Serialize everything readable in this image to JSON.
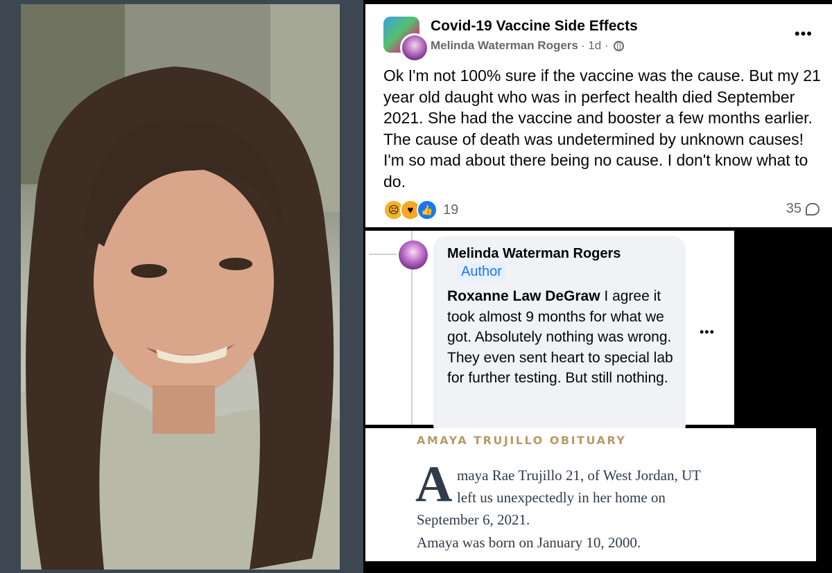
{
  "post": {
    "group_name": "Covid-19 Vaccine Side Effects",
    "author": "Melinda Waterman Rogers",
    "time": "· 1d ·",
    "more": "•••",
    "text": "Ok I'm not 100% sure if the vaccine was the cause. But my 21 year old daught who was in perfect health died September 2021. She had the vaccine and booster a few months earlier. The cause of death was undetermined by unknown causes! I'm so mad about there being no cause. I don't know what to do.",
    "reaction_count": "19",
    "comment_count": "35",
    "reaction_icons": [
      "sad-react-icon",
      "care-react-icon",
      "like-react-icon"
    ]
  },
  "comment": {
    "name": "Melinda Waterman Rogers",
    "badge": "Author",
    "mention": "Roxanne Law DeGraw",
    "text": " I agree it took almost 9 months for what we got. Absolutely nothing was wrong. They even sent heart to special lab for further testing. But still nothing.",
    "more": "•••"
  },
  "obituary": {
    "title": "AMAYA TRUJILLO OBITUARY",
    "drop_cap": "A",
    "line1": "maya Rae Trujillo 21, of West Jordan, UT",
    "line2": "left us unexpectedly in her home on",
    "line3": "September 6, 2021.",
    "line4": "Amaya was born on January 10, 2000."
  },
  "colors": {
    "facebook_blue": "#1877f2",
    "meta_gray": "#65676b",
    "obit_gold": "#b89a66",
    "obit_text": "#2f3b4a"
  }
}
